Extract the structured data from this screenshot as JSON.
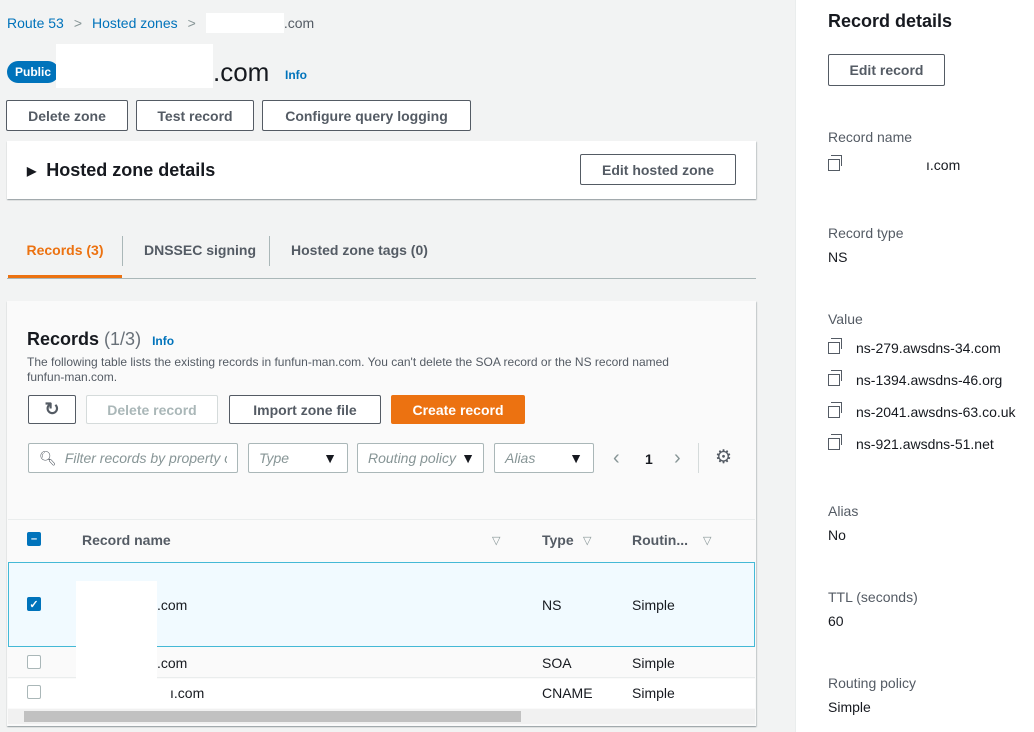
{
  "breadcrumb": {
    "items": [
      "Route 53",
      "Hosted zones"
    ],
    "current_suffix": ".com"
  },
  "header": {
    "badge": "Public",
    "title_suffix": ".com",
    "info": "Info"
  },
  "actions": {
    "delete_zone": "Delete zone",
    "test_record": "Test record",
    "configure_logging": "Configure query logging"
  },
  "zone_details": {
    "title": "Hosted zone details",
    "edit": "Edit hosted zone"
  },
  "tabs": [
    {
      "label": "Records (3)",
      "active": true
    },
    {
      "label": "DNSSEC signing"
    },
    {
      "label": "Hosted zone tags (0)"
    }
  ],
  "records": {
    "title": "Records",
    "count": "(1/3)",
    "info": "Info",
    "description": "The following table lists the existing records in funfun-man.com. You can't delete the SOA record or the NS record named funfun-man.com.",
    "delete": "Delete record",
    "import": "Import zone file",
    "create": "Create record",
    "filter_placeholder": "Filter records by property o",
    "type_filter": "Type",
    "routing_filter": "Routing policy",
    "alias_filter": "Alias",
    "page": "1",
    "columns": [
      "Record name",
      "Type",
      "Routin..."
    ],
    "rows": [
      {
        "name": ".com",
        "type": "NS",
        "routing": "Simple",
        "selected": true
      },
      {
        "name": ".com",
        "type": "SOA",
        "routing": "Simple",
        "selected": false
      },
      {
        "name": "ı.com",
        "type": "CNAME",
        "routing": "Simple",
        "selected": false
      }
    ]
  },
  "details": {
    "title": "Record details",
    "edit": "Edit record",
    "record_name_label": "Record name",
    "record_name": "ı.com",
    "record_type_label": "Record type",
    "record_type": "NS",
    "value_label": "Value",
    "values": [
      "ns-279.awsdns-34.com",
      "ns-1394.awsdns-46.org",
      "ns-2041.awsdns-63.co.uk",
      "ns-921.awsdns-51.net"
    ],
    "alias_label": "Alias",
    "alias": "No",
    "ttl_label": "TTL (seconds)",
    "ttl": "60",
    "routing_label": "Routing policy",
    "routing": "Simple"
  },
  "colors": {
    "accent": "#ec7211",
    "link": "#0073bb",
    "selected_row": "#f1faff"
  }
}
